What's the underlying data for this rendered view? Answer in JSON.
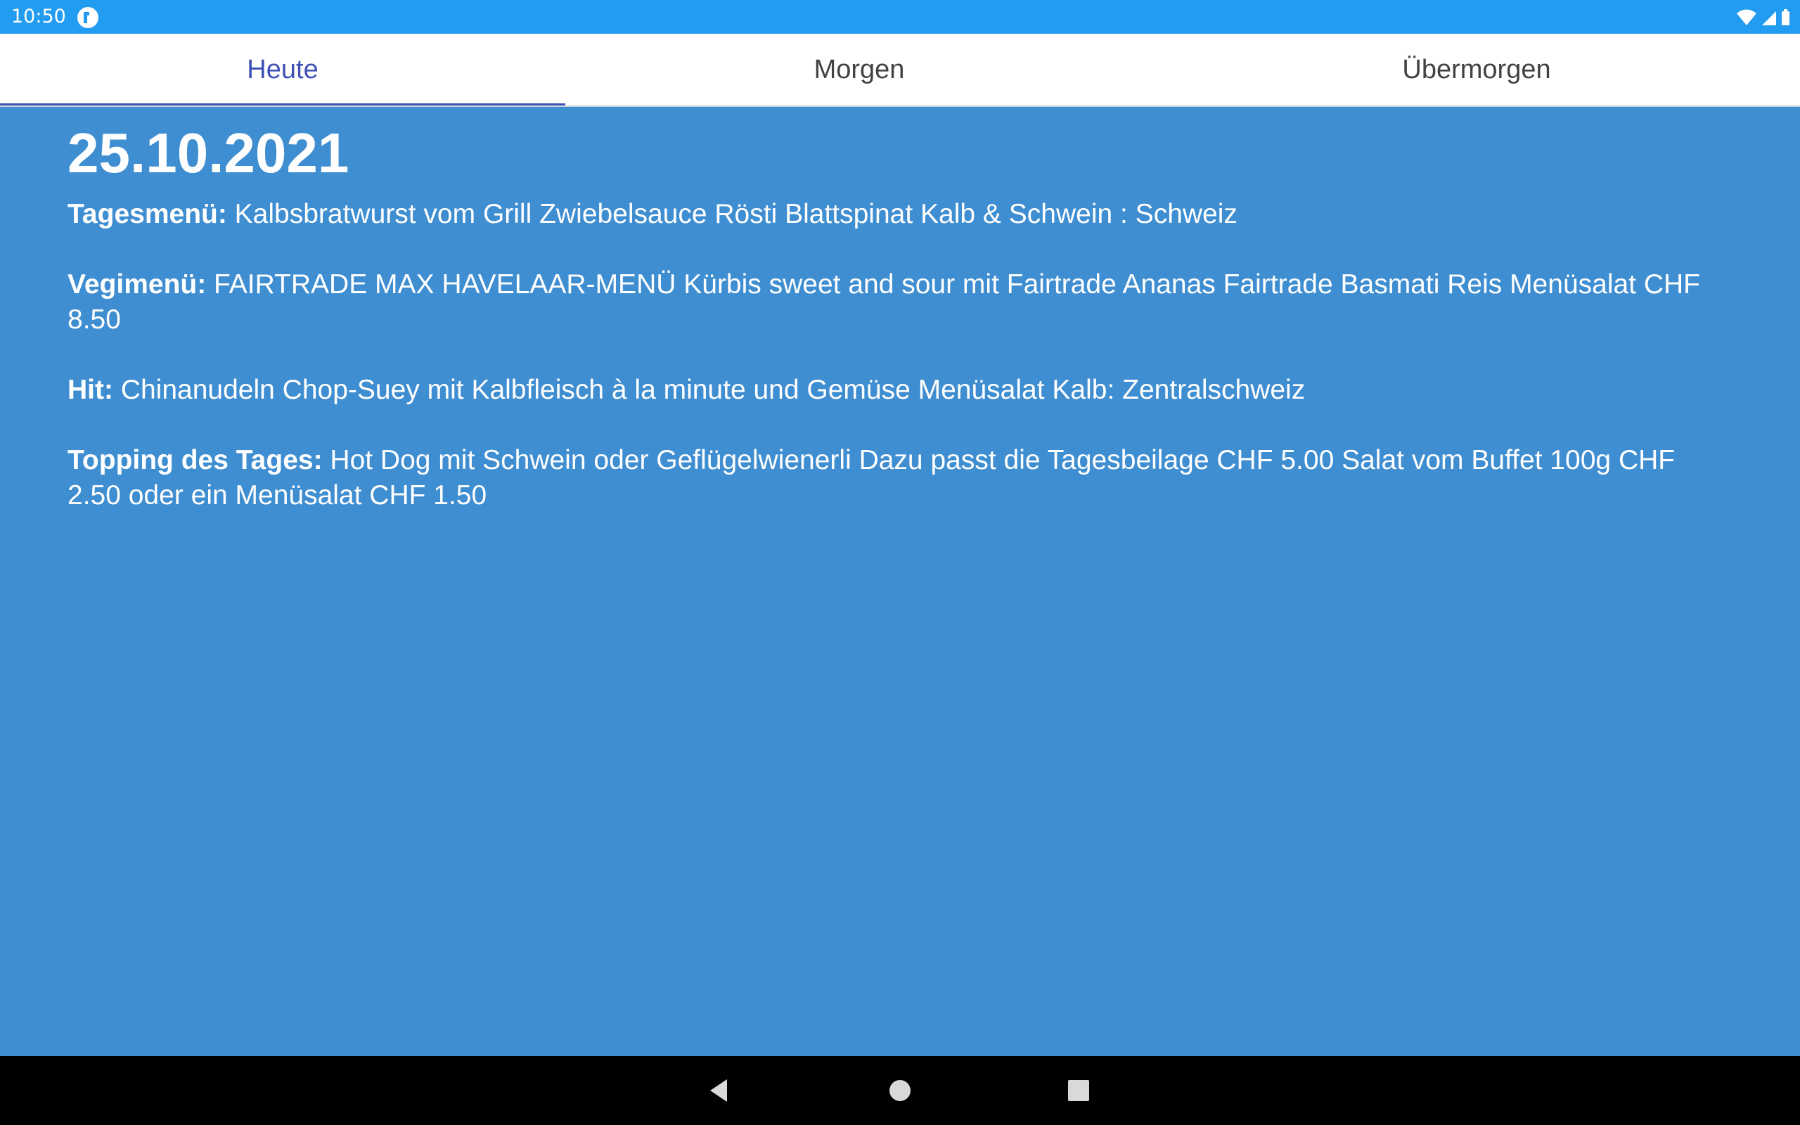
{
  "status_bar": {
    "time": "10:50",
    "icons": [
      "app-notification-icon",
      "wifi-icon",
      "cell-signal-icon",
      "battery-icon"
    ],
    "color": "#229cf0"
  },
  "tabs": [
    {
      "label": "Heute",
      "active": true
    },
    {
      "label": "Morgen",
      "active": false
    },
    {
      "label": "Übermorgen",
      "active": false
    }
  ],
  "main": {
    "date": "25.10.2021",
    "background_color": "#3f8ed1",
    "menus": [
      {
        "label": "Tagesmenü:",
        "text": " Kalbsbratwurst vom Grill Zwiebelsauce Rösti Blattspinat Kalb & Schwein : Schweiz"
      },
      {
        "label": "Vegimenü:",
        "text": " FAIRTRADE MAX HAVELAAR-MENÜ Kürbis sweet and sour mit Fairtrade Ananas Fairtrade Basmati Reis Menüsalat CHF 8.50"
      },
      {
        "label": "Hit:",
        "text": " Chinanudeln Chop-Suey mit Kalbfleisch à la minute und Gemüse Menüsalat Kalb: Zentralschweiz"
      },
      {
        "label": "Topping des Tages:",
        "text": " Hot Dog mit Schwein oder Geflügelwienerli Dazu passt die Tagesbeilage CHF 5.00 Salat vom Buffet 100g CHF 2.50 oder ein Menüsalat CHF 1.50"
      }
    ]
  },
  "nav_bar": {
    "buttons": [
      "back-icon",
      "home-icon",
      "recents-icon"
    ]
  }
}
